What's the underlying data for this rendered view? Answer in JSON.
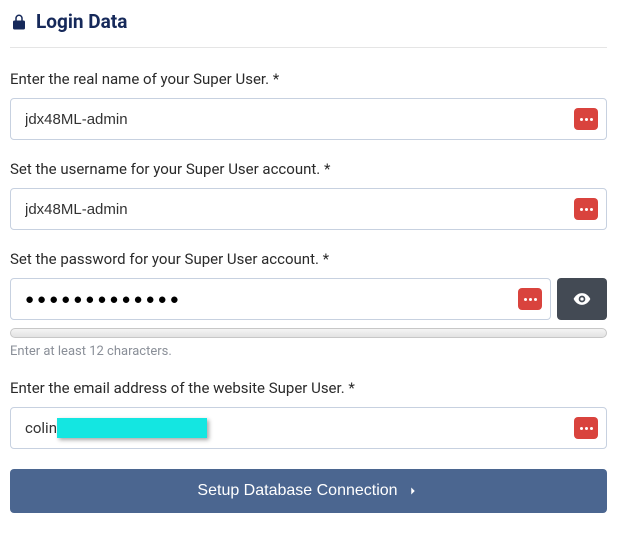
{
  "header": {
    "title": "Login Data"
  },
  "fields": {
    "realname": {
      "label": "Enter the real name of your Super User. *",
      "value": "jdx48ML-admin"
    },
    "username": {
      "label": "Set the username for your Super User account. *",
      "value": "jdx48ML-admin"
    },
    "password": {
      "label": "Set the password for your Super User account. *",
      "mask": "●●●●●●●●●●●●●",
      "hint": "Enter at least 12 characters."
    },
    "email": {
      "label": "Enter the email address of the website Super User. *",
      "prefix": "colin"
    }
  },
  "submit": {
    "label": "Setup Database Connection"
  }
}
